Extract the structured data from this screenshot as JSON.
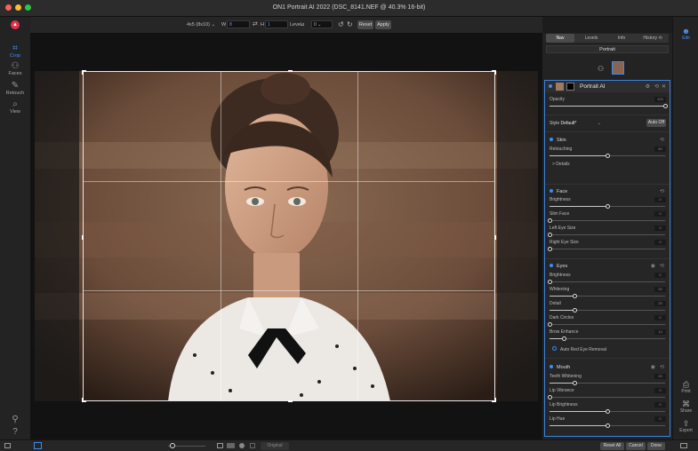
{
  "window": {
    "title": "ON1 Portrait AI 2022 (DSC_8141.NEF @ 40.3% 16-bit)"
  },
  "toolbar": {
    "preset": "4x5 (8x10) ⌄",
    "w_label": "W",
    "w_value": "8",
    "h_label": "H",
    "h_value": "1",
    "level_label": "Level",
    "angle_value": "0 ⌄",
    "reset_label": "Reset",
    "apply_label": "Apply"
  },
  "left_tools": [
    {
      "name": "Crop",
      "icon": "crop-icon"
    },
    {
      "name": "Faces",
      "icon": "faces-icon"
    },
    {
      "name": "Retouch",
      "icon": "retouch-icon"
    },
    {
      "name": "View",
      "icon": "view-icon"
    }
  ],
  "right_tabs": [
    "Nav",
    "Levels",
    "Info",
    "History ⟲"
  ],
  "portrait_label": "Portrait",
  "layer": {
    "title": "Portrait AI",
    "opacity_label": "Opacity",
    "opacity_value": "100",
    "opacity": 1.0,
    "style_label": "Style",
    "style_value": "Default*",
    "auto_label": "Auto Off"
  },
  "sections": {
    "skin": {
      "title": "Skin",
      "retouching_label": "Retouching",
      "retouching_value": "50",
      "retouching": 0.5,
      "details_label": "> Details"
    },
    "face": {
      "title": "Face",
      "sliders": [
        {
          "label": "Brightness",
          "value": "0",
          "level": 0.5
        },
        {
          "label": "Slim Face",
          "value": "0",
          "level": 0.0
        },
        {
          "label": "Left Eye Size",
          "value": "0",
          "level": 0.0
        },
        {
          "label": "Right Eye Size",
          "value": "0",
          "level": 0.0
        }
      ]
    },
    "eyes": {
      "title": "Eyes",
      "sliders": [
        {
          "label": "Brightness",
          "value": "0",
          "level": 0.0
        },
        {
          "label": "Whitening",
          "value": "25",
          "level": 0.22
        },
        {
          "label": "Detail",
          "value": "25",
          "level": 0.22
        },
        {
          "label": "Dark Circles",
          "value": "0",
          "level": 0.0
        },
        {
          "label": "Brow Enhance",
          "value": "14",
          "level": 0.13
        }
      ],
      "auto_red_eye_label": "Auto Red Eye Removal"
    },
    "mouth": {
      "title": "Mouth",
      "sliders": [
        {
          "label": "Teeth Whitening",
          "value": "25",
          "level": 0.22
        },
        {
          "label": "Lip Vibrance",
          "value": "0",
          "level": 0.0
        },
        {
          "label": "Lip Brightness",
          "value": "0",
          "level": 0.5
        },
        {
          "label": "Lip Hue",
          "value": "0",
          "level": 0.5
        }
      ]
    }
  },
  "far_right": {
    "edit_label": "Edit",
    "print_label": "Print",
    "share_label": "Share",
    "export_label": "Export"
  },
  "bottom": {
    "original_label": "Original",
    "reset_all_label": "Reset All",
    "cancel_label": "Cancel",
    "done_label": "Done"
  },
  "colors": {
    "accent": "#3d8cf2",
    "close": "#ff5f57",
    "minimize": "#febc2e",
    "zoom": "#28c840",
    "app_badge": "#e2324b"
  }
}
